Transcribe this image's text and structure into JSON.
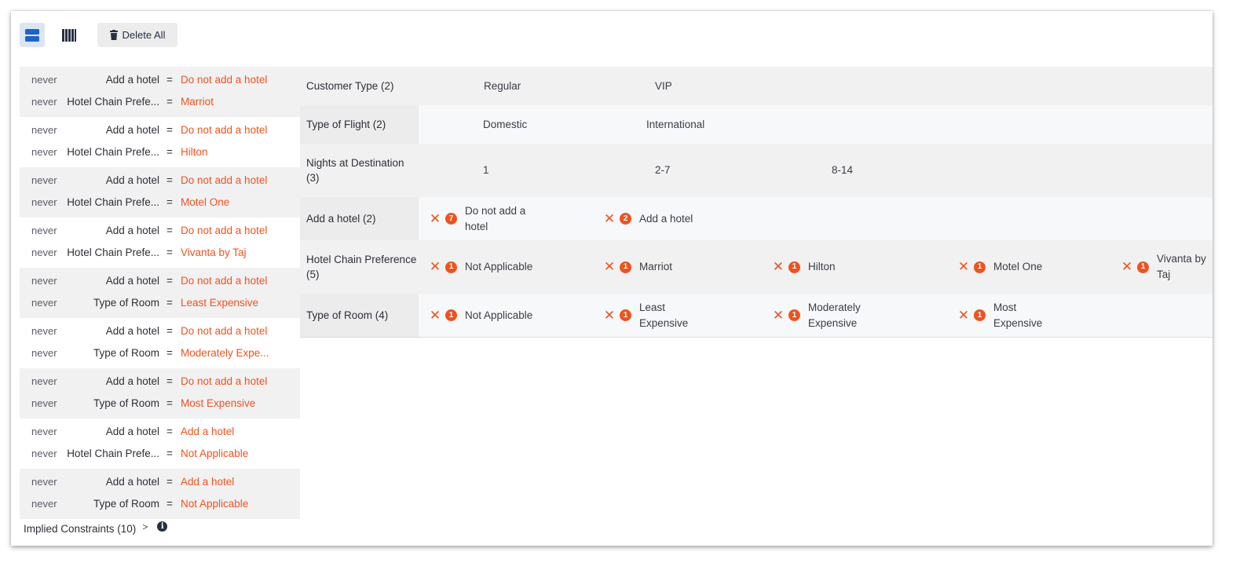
{
  "toolbar": {
    "rows_view": "rows-view-icon",
    "cols_view": "columns-view-icon",
    "delete_all_label": "Delete All"
  },
  "constraints": [
    {
      "lines": [
        {
          "kw": "never",
          "attr": "Add a hotel",
          "eq": "=",
          "val": "Do not add a hotel"
        },
        {
          "kw": "never",
          "attr": "Hotel Chain Prefe...",
          "eq": "=",
          "val": "Marriot"
        }
      ]
    },
    {
      "lines": [
        {
          "kw": "never",
          "attr": "Add a hotel",
          "eq": "=",
          "val": "Do not add a hotel"
        },
        {
          "kw": "never",
          "attr": "Hotel Chain Prefe...",
          "eq": "=",
          "val": "Hilton"
        }
      ]
    },
    {
      "lines": [
        {
          "kw": "never",
          "attr": "Add a hotel",
          "eq": "=",
          "val": "Do not add a hotel"
        },
        {
          "kw": "never",
          "attr": "Hotel Chain Prefe...",
          "eq": "=",
          "val": "Motel One"
        }
      ]
    },
    {
      "lines": [
        {
          "kw": "never",
          "attr": "Add a hotel",
          "eq": "=",
          "val": "Do not add a hotel"
        },
        {
          "kw": "never",
          "attr": "Hotel Chain Prefe...",
          "eq": "=",
          "val": "Vivanta by Taj"
        }
      ]
    },
    {
      "lines": [
        {
          "kw": "never",
          "attr": "Add a hotel",
          "eq": "=",
          "val": "Do not add a hotel"
        },
        {
          "kw": "never",
          "attr": "Type of Room",
          "eq": "=",
          "val": "Least Expensive"
        }
      ]
    },
    {
      "lines": [
        {
          "kw": "never",
          "attr": "Add a hotel",
          "eq": "=",
          "val": "Do not add a hotel"
        },
        {
          "kw": "never",
          "attr": "Type of Room",
          "eq": "=",
          "val": "Moderately Expe..."
        }
      ]
    },
    {
      "lines": [
        {
          "kw": "never",
          "attr": "Add a hotel",
          "eq": "=",
          "val": "Do not add a hotel"
        },
        {
          "kw": "never",
          "attr": "Type of Room",
          "eq": "=",
          "val": "Most Expensive"
        }
      ]
    },
    {
      "lines": [
        {
          "kw": "never",
          "attr": "Add a hotel",
          "eq": "=",
          "val": "Add a hotel"
        },
        {
          "kw": "never",
          "attr": "Hotel Chain Prefe...",
          "eq": "=",
          "val": "Not Applicable"
        }
      ]
    },
    {
      "lines": [
        {
          "kw": "never",
          "attr": "Add a hotel",
          "eq": "=",
          "val": "Add a hotel"
        },
        {
          "kw": "never",
          "attr": "Type of Room",
          "eq": "=",
          "val": "Not Applicable"
        }
      ]
    }
  ],
  "implied": {
    "label": "Implied Constraints (10)",
    "chevron": ">",
    "info": "i"
  },
  "parameters": [
    {
      "name": "Customer Type (2)",
      "values": [
        {
          "text": "Regular"
        },
        {
          "text": "VIP"
        }
      ]
    },
    {
      "name": "Type of Flight (2)",
      "values": [
        {
          "text": "Domestic"
        },
        {
          "text": "International"
        }
      ]
    },
    {
      "name": "Nights at Destination (3)",
      "values": [
        {
          "text": "1"
        },
        {
          "text": "2-7"
        },
        {
          "text": "8-14"
        }
      ]
    },
    {
      "name": "Add a hotel (2)",
      "values": [
        {
          "text": "Do not add a hotel",
          "count": "7"
        },
        {
          "text": "Add a hotel",
          "count": "2"
        }
      ]
    },
    {
      "name": "Hotel Chain Preference (5)",
      "values": [
        {
          "text": "Not Applicable",
          "count": "1"
        },
        {
          "text": "Marriot",
          "count": "1"
        },
        {
          "text": "Hilton",
          "count": "1"
        },
        {
          "text": "Motel One",
          "count": "1"
        },
        {
          "text": "Vivanta by Taj",
          "count": "1"
        }
      ]
    },
    {
      "name": "Type of Room (4)",
      "values": [
        {
          "text": "Not Applicable",
          "count": "1"
        },
        {
          "text": "Least Expensive",
          "count": "1"
        },
        {
          "text": "Moderately Expensive",
          "count": "1"
        },
        {
          "text": "Most Expensive",
          "count": "1"
        }
      ]
    }
  ],
  "colors": {
    "accent": "#f0521f",
    "selected_view": "#dbe6f5",
    "text": "#2c2f36"
  }
}
